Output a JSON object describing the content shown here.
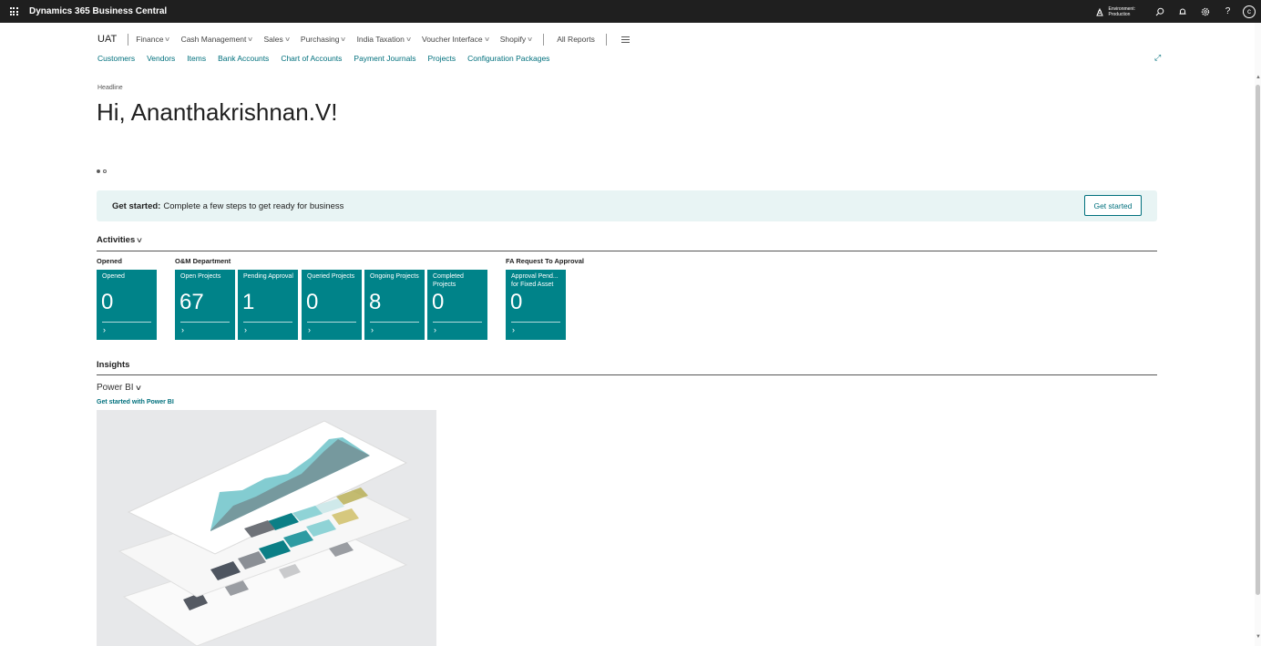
{
  "app": {
    "title": "Dynamics 365 Business Central"
  },
  "environment": {
    "line1": "Environment:",
    "line2": "Production"
  },
  "topbar_icons": [
    "search-icon",
    "bell-icon",
    "settings-icon",
    "help-icon"
  ],
  "user": {
    "initial": "c"
  },
  "nav": {
    "company": "UAT",
    "menus": [
      "Finance",
      "Cash Management",
      "Sales",
      "Purchasing",
      "India Taxation",
      "Voucher Interface",
      "Shopify"
    ],
    "all_reports": "All Reports"
  },
  "quick_links": [
    "Customers",
    "Vendors",
    "Items",
    "Bank Accounts",
    "Chart of Accounts",
    "Payment Journals",
    "Projects",
    "Configuration Packages"
  ],
  "headline": {
    "label": "Headline",
    "greeting": "Hi, Ananthakrishnan.V!"
  },
  "banner": {
    "bold": "Get started:",
    "text": "Complete a few steps to get ready for business",
    "button": "Get started"
  },
  "activities": {
    "title": "Activities",
    "groups": [
      {
        "title": "Opened",
        "tiles": [
          {
            "label": "Opened",
            "value": "0"
          }
        ]
      },
      {
        "title": "O&M Department",
        "tiles": [
          {
            "label": "Open Projects",
            "value": "67"
          },
          {
            "label": "Pending Approval",
            "value": "1"
          },
          {
            "label": "Queried Projects",
            "value": "0"
          },
          {
            "label": "Ongoing Projects",
            "value": "8"
          },
          {
            "label": "Completed Projects",
            "value": "0"
          }
        ]
      },
      {
        "title": "FA Request To Approval",
        "tiles": [
          {
            "label": "Approval Pend... for Fixed Asset",
            "value": "0"
          }
        ]
      }
    ]
  },
  "insights": {
    "title": "Insights",
    "powerbi": "Power BI",
    "link": "Get started with Power BI"
  },
  "colors": {
    "accent": "#00707d",
    "tile": "#008389",
    "banner": "#e8f4f4",
    "topbar": "#1f1f1f"
  }
}
